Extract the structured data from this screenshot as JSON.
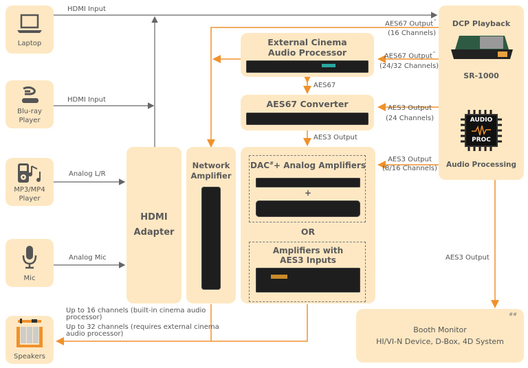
{
  "colors": {
    "box": "#fde8c3",
    "orange": "#f0922b",
    "gray_line": "#666666",
    "text": "#555555"
  },
  "sources": [
    {
      "id": "laptop",
      "label": "Laptop",
      "icon": "laptop-icon",
      "connection": "HDMI Input"
    },
    {
      "id": "bluray",
      "label_line1": "Blu-ray",
      "label_line2": "Player",
      "icon": "bluray-icon",
      "connection": "HDMI Input"
    },
    {
      "id": "mp3",
      "label_line1": "MP3/MP4",
      "label_line2": "Player",
      "icon": "mp3-player-icon",
      "connection": "Analog L/R"
    },
    {
      "id": "mic",
      "label": "Mic",
      "icon": "microphone-icon",
      "connection": "Analog Mic"
    }
  ],
  "speakers": {
    "label": "Speakers",
    "note1_line1": "Up to 16 channels (built-in cinema audio",
    "note1_line2": "processor)",
    "note2_line1": "Up to 32 channels (requires external cinema",
    "note2_line2": "audio processor)"
  },
  "hdmi_adapter": {
    "line1": "HDMI",
    "line2": "Adapter"
  },
  "network_amp": {
    "line1": "Network",
    "line2": "Amplifier"
  },
  "external_processor": {
    "line1": "External Cinema",
    "line2": "Audio Processor"
  },
  "aes67_link": "AES67",
  "converter": {
    "title": "AES67 Converter",
    "output": "AES3 Output"
  },
  "amps_group": {
    "dac_title": "DAC",
    "dac_sup": "#",
    "dac_rest": "+ Analog Amplifiers",
    "plus": "+",
    "or": "OR",
    "aes3_line1": "Amplifiers with",
    "aes3_line2": "AES3 Inputs"
  },
  "dcp": {
    "title": "DCP Playback",
    "model": "SR-1000",
    "chip_line1": "AUDIO",
    "chip_line2": "PROC",
    "processing": "Audio Processing"
  },
  "outputs": {
    "aes67_16_line1": "AES67 Output",
    "aes67_16_sup": "^",
    "aes67_16_line2": "(16 Channels)",
    "aes67_2432_line1": "AES67 Output",
    "aes67_2432_sup": "^",
    "aes67_2432_line2": "(24/32 Channels)",
    "aes3_24_line1": "AES3 Output",
    "aes3_24_line2": "(24 Channels)",
    "aes3_816_line1": "AES3 Output",
    "aes3_816_line2": "(8/16 Channels)",
    "aes3_booth": "AES3 Output"
  },
  "booth": {
    "mark": "##",
    "line1": "Booth Monitor",
    "line2": "HI/VI-N Device, D-Box, 4D System"
  }
}
